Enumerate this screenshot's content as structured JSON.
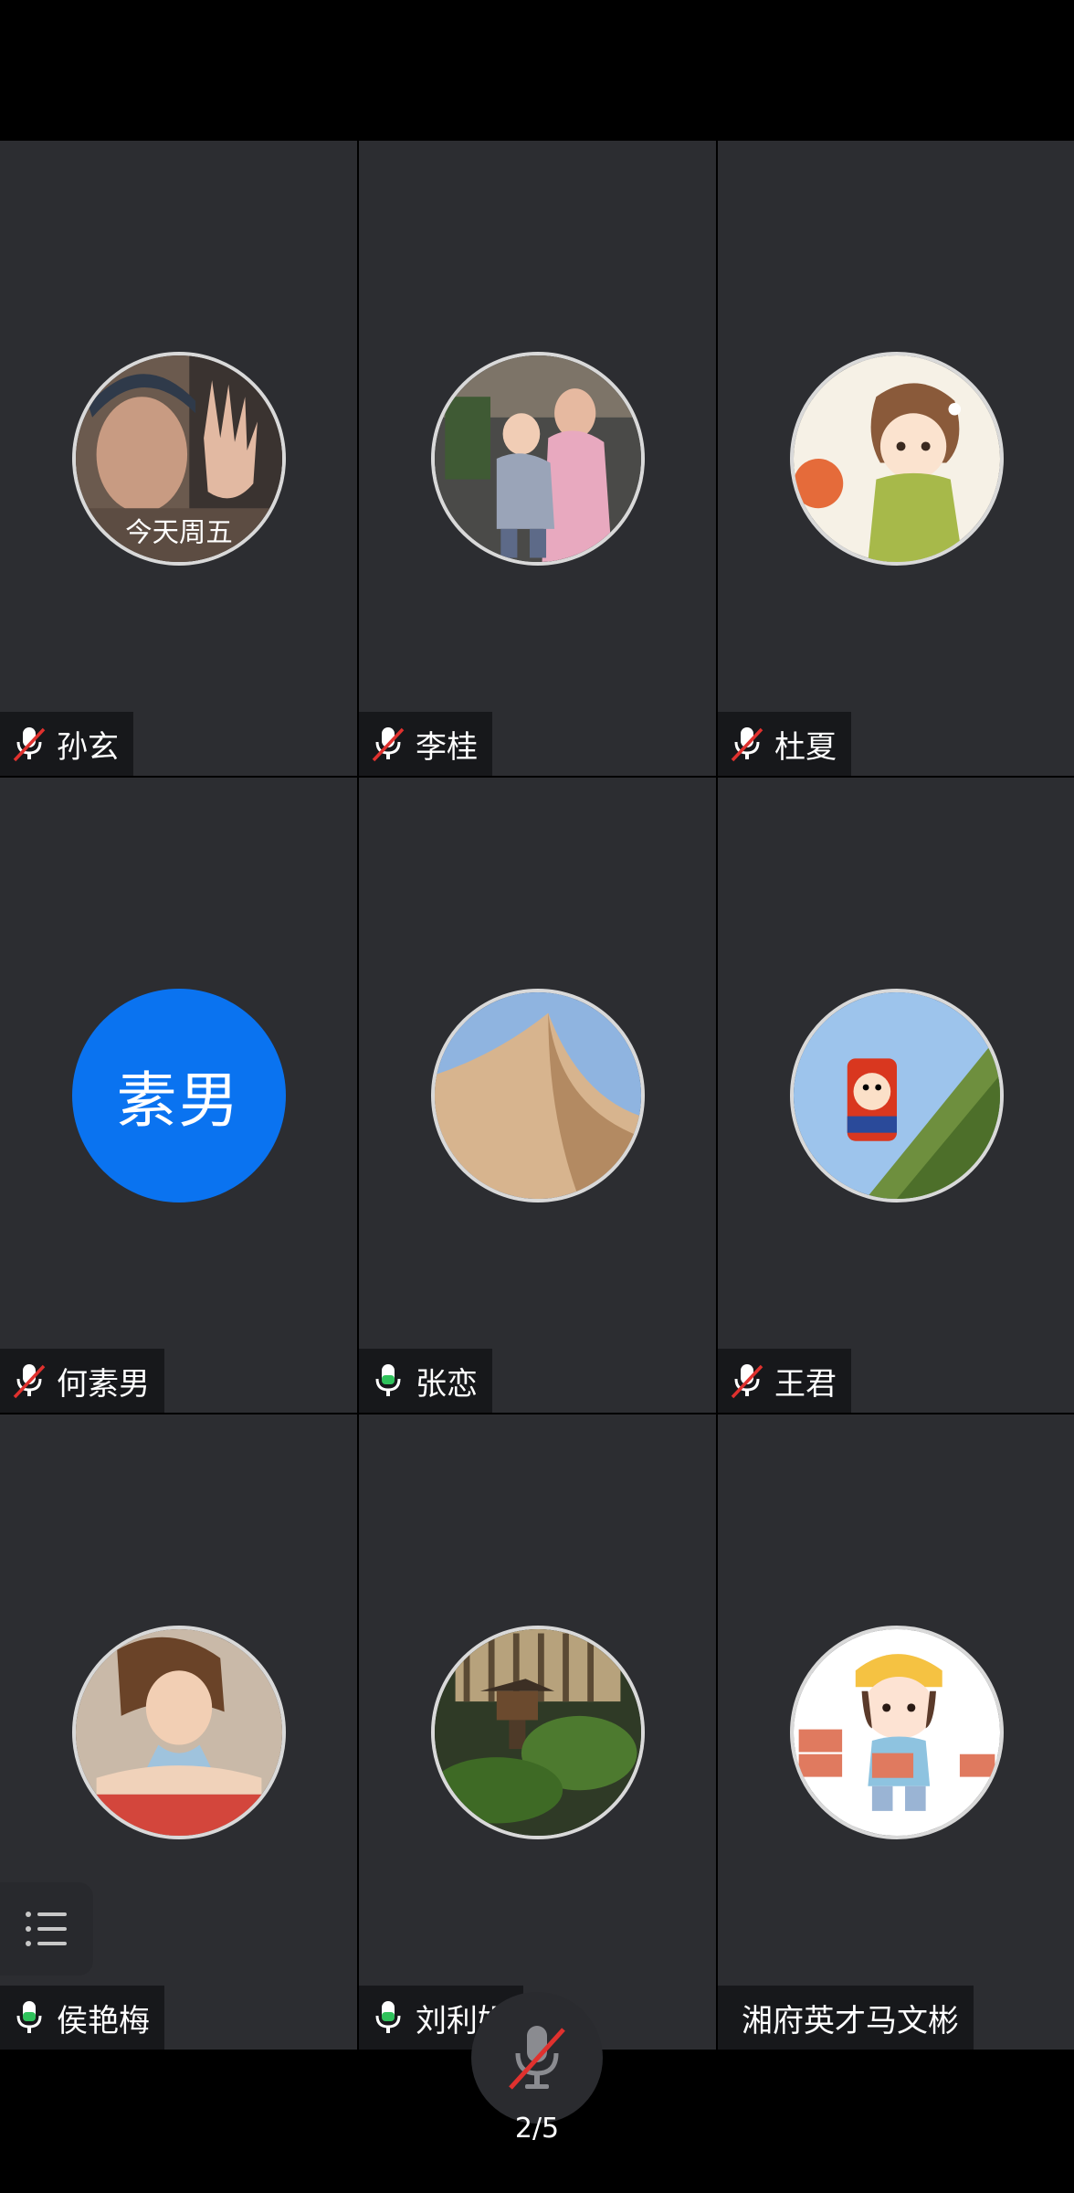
{
  "participants": [
    {
      "name": "孙玄",
      "mic": "muted",
      "avatar_caption": "今天周五"
    },
    {
      "name": "李桂",
      "mic": "muted"
    },
    {
      "name": "杜夏",
      "mic": "muted"
    },
    {
      "name": "何素男",
      "mic": "muted",
      "avatar_text": "素男",
      "avatar_color": "#0a73f0"
    },
    {
      "name": "张恋",
      "mic": "active"
    },
    {
      "name": "王君",
      "mic": "muted"
    },
    {
      "name": "侯艳梅",
      "mic": "active"
    },
    {
      "name": "刘利娟",
      "mic": "active"
    },
    {
      "name": "湘府英才马文彬",
      "mic": "none"
    }
  ],
  "controls": {
    "page_indicator": "2/5",
    "self_mic": "muted"
  },
  "colors": {
    "tile_bg": "#2c2d31",
    "mic_active": "#2fc25b",
    "mic_muted_slash": "#e0312e",
    "avatar_blue": "#0a73f0"
  }
}
